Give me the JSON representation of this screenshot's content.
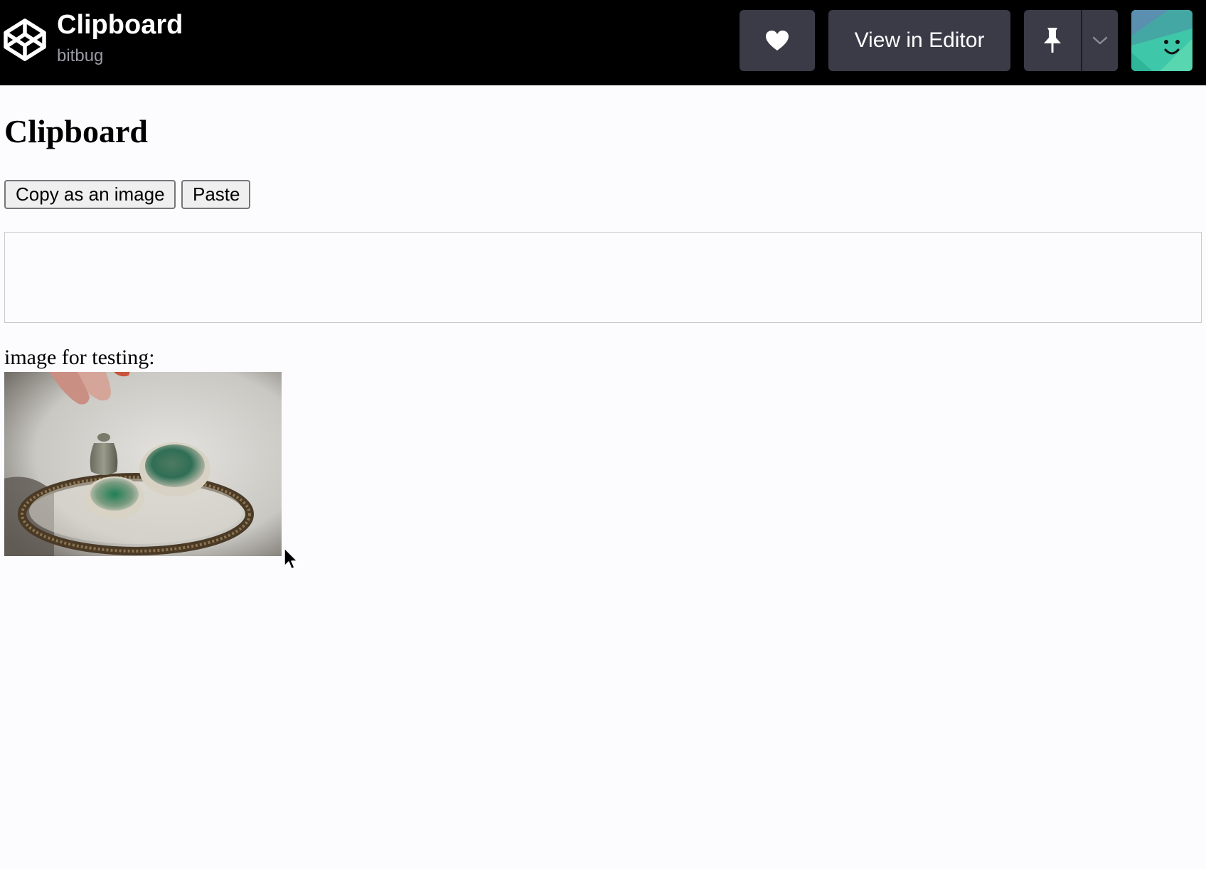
{
  "header": {
    "pen_title": "Clipboard",
    "author": "bitbug",
    "editor_button_label": "View in Editor",
    "icons": [
      "codepen-logo-icon",
      "heart-icon",
      "pin-icon",
      "chevron-down-icon",
      "avatar"
    ]
  },
  "page": {
    "heading": "Clipboard",
    "copy_button_label": "Copy as an image",
    "paste_button_label": "Paste",
    "paste_area_text": "",
    "image_label": "image for testing:"
  },
  "colors": {
    "topbar_bg": "#000000",
    "topbar_button_bg": "#3a3b47",
    "author_text": "#9a9aa5",
    "page_bg": "#fcfcfe"
  }
}
